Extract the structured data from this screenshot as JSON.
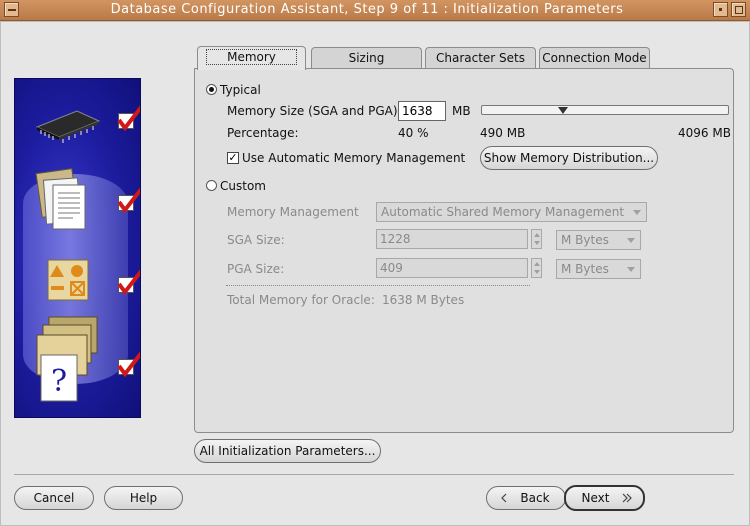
{
  "window": {
    "title": "Database Configuration Assistant, Step 9 of 11 : Initialization Parameters"
  },
  "tabs": [
    {
      "label": "Memory",
      "active": true
    },
    {
      "label": "Sizing"
    },
    {
      "label": "Character Sets"
    },
    {
      "label": "Connection Mode"
    }
  ],
  "memory": {
    "typical_label": "Typical",
    "memory_size_label": "Memory Size (SGA and PGA):",
    "memory_size_value": "1638",
    "memory_size_unit": "MB",
    "percentage_label": "Percentage:",
    "percentage_value": "40 %",
    "slider_min": "490 MB",
    "slider_max": "4096 MB",
    "slider_fraction": 0.32,
    "auto_mm_label": "Use Automatic Memory Management",
    "auto_mm_checked": true,
    "show_distribution_button": "Show Memory Distribution...",
    "custom_label": "Custom",
    "memory_management_label": "Memory Management",
    "memory_management_value": "Automatic Shared Memory Management",
    "sga_label": "SGA Size:",
    "sga_value": "1228",
    "sga_unit": "M Bytes",
    "pga_label": "PGA Size:",
    "pga_value": "409",
    "pga_unit": "M Bytes",
    "total_label": "Total Memory for Oracle:",
    "total_value": "1638 M Bytes"
  },
  "all_params_button": "All Initialization Parameters...",
  "footer": {
    "cancel": "Cancel",
    "help": "Help",
    "back": "Back",
    "next": "Next"
  },
  "icons": [
    "memory-chip-icon",
    "documents-icon",
    "shapes-icon",
    "folders-help-icon",
    "checkmark-icon"
  ],
  "colors": {
    "titlebar": "#c3875a",
    "art_bg": "#1c1c9e",
    "check": "#d01818"
  }
}
